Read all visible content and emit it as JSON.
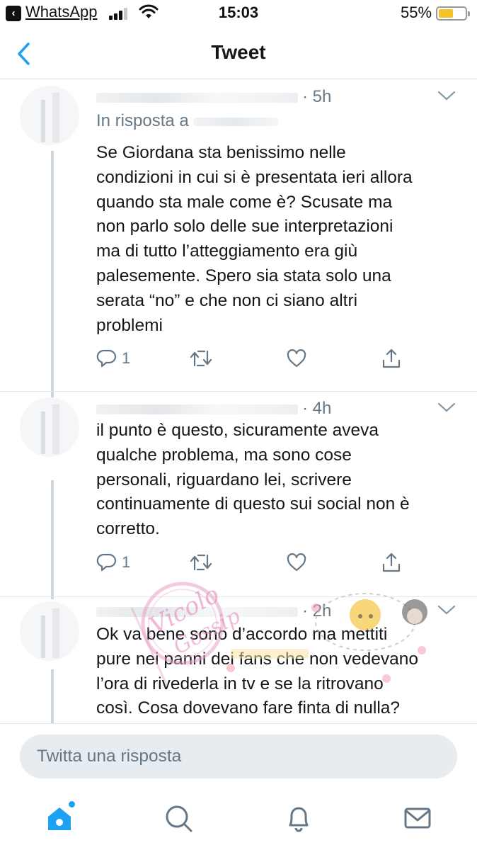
{
  "status_bar": {
    "back_app": "WhatsApp",
    "time": "15:03",
    "battery_percent": "55%",
    "battery_level": 0.55,
    "signal_bars": 3
  },
  "nav": {
    "title": "Tweet",
    "back_icon": "chevron-left-icon"
  },
  "colors": {
    "accent": "#1da1f2",
    "secondary_text": "#657786",
    "divider": "#e1e8ed",
    "input_background": "#e6ecf0"
  },
  "tweets": [
    {
      "time": "5h",
      "reply_prefix": "In risposta a",
      "text_lines": [
        "Se Giordana sta benissimo nelle",
        "condizioni in cui si è presentata ieri allora",
        "quando sta male come è? Scusate ma",
        "non parlo solo delle sue interpretazioni",
        "ma di tutto l’atteggiamento era giù",
        "palesemente. Spero sia stata solo una",
        "serata “no” e che non ci siano altri",
        "problemi"
      ],
      "reply_count": "1"
    },
    {
      "time": "4h",
      "text_lines": [
        "il punto è questo, sicuramente aveva",
        "qualche problema, ma sono cose",
        "personali, riguardano lei, scrivere",
        "continuamente di questo sui social non è",
        "corretto."
      ],
      "reply_count": "1"
    },
    {
      "time": "2h",
      "text_lines": [
        "Ok va bene sono d’accordo ma mettiti",
        "pure nei panni dei fans che non vedevano",
        "l’ora di rivederla in tv e se la ritrovano",
        "così. Cosa dovevano fare finta di nulla?"
      ]
    }
  ],
  "watermark": {
    "text": "Vicolo Gossip"
  },
  "reply_bar": {
    "placeholder": "Twitta una risposta"
  },
  "tab_bar": {
    "items": [
      "home-icon",
      "search-icon",
      "notifications-icon",
      "messages-icon"
    ],
    "active": "home-icon"
  }
}
